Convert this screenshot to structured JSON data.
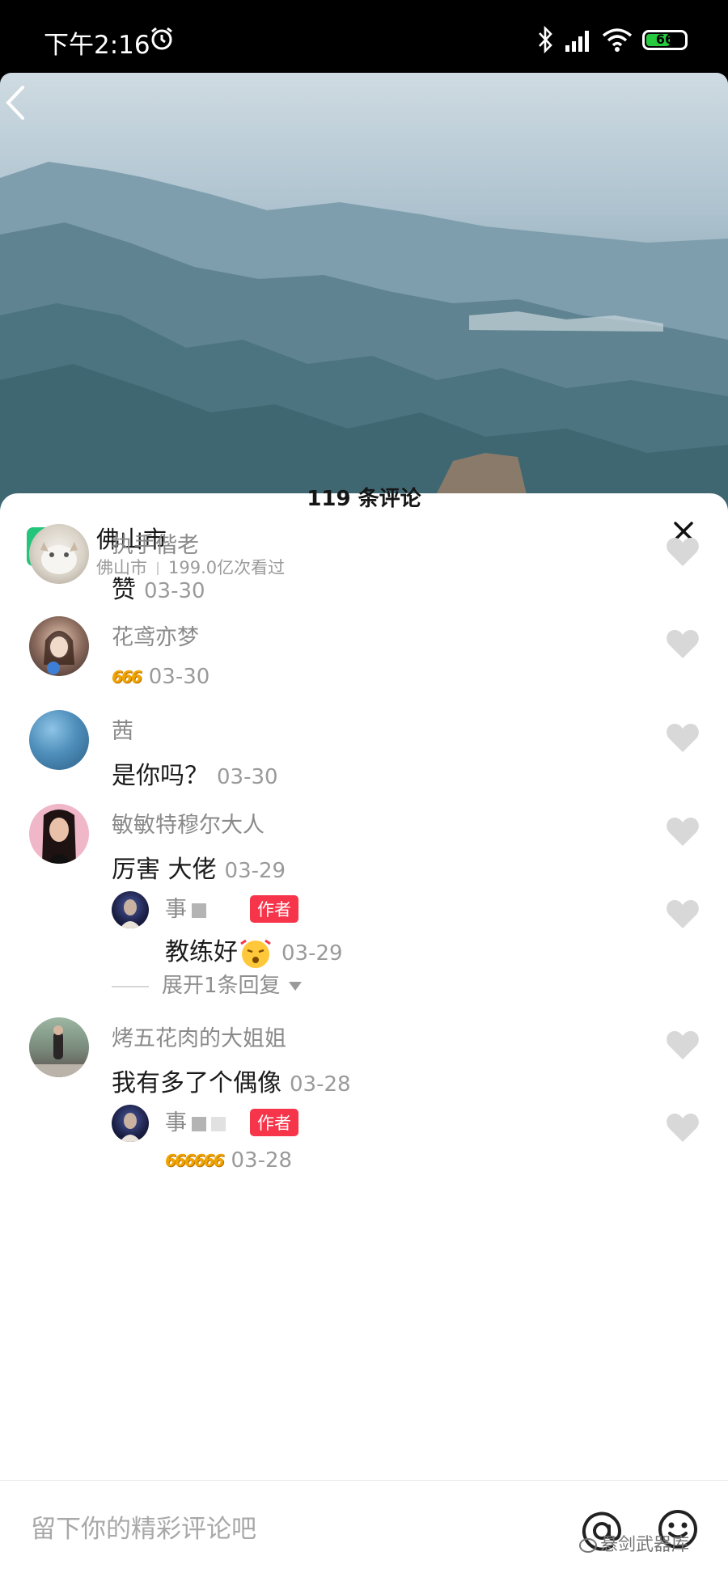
{
  "status_bar": {
    "time": "下午2:16",
    "battery": "66",
    "battery_level": 0.66
  },
  "location": {
    "name": "佛山市",
    "subtitle_city": "佛山市",
    "views": "199.0亿次看过"
  },
  "comments_header": {
    "count_label": "119 条评论"
  },
  "comments": [
    {
      "name": "执手偕老",
      "text": "赞",
      "date": "03-30"
    },
    {
      "name": "花鸢亦梦",
      "text": "666",
      "date": "03-30"
    },
    {
      "name": "茜",
      "text": "是你吗？",
      "date": "03-30"
    },
    {
      "name": "敏敏特穆尔大人",
      "text": "厉害 大佬",
      "date": "03-29"
    },
    {
      "name": "烤五花肉的大姐姐",
      "text": "我有多了个偶像",
      "date": "03-28"
    }
  ],
  "replies": [
    {
      "name": "事",
      "badge": "作者",
      "text": "教练好",
      "date": "03-29"
    },
    {
      "name": "事",
      "badge": "作者",
      "text": "666666",
      "date": "03-28"
    }
  ],
  "expand_replies": {
    "label": "展开1条回复"
  },
  "input": {
    "placeholder": "留下你的精彩评论吧"
  },
  "watermark": {
    "text": "悬剑武器库"
  },
  "colors": {
    "accent_red": "#f6354b",
    "location_green": "#23c57b"
  }
}
